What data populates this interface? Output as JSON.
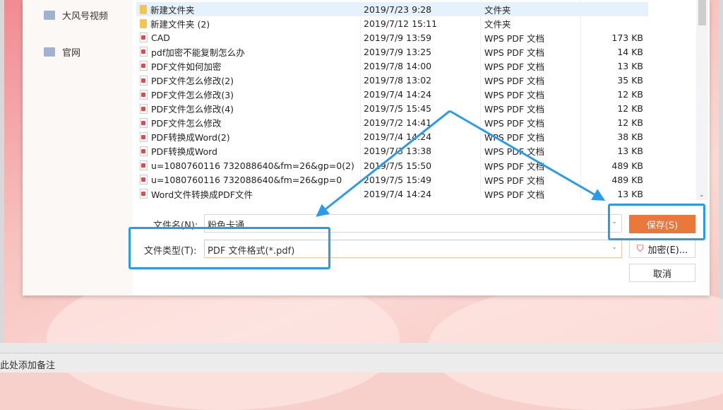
{
  "nav": {
    "items": [
      {
        "label": "大风号视频"
      },
      {
        "label": "官网"
      }
    ]
  },
  "files": [
    {
      "name": "新建文件夹",
      "date": "2019/7/23 9:28",
      "type": "文件夹",
      "size": "",
      "kind": "folder",
      "selected": true
    },
    {
      "name": "新建文件夹 (2)",
      "date": "2019/7/12 15:11",
      "type": "文件夹",
      "size": "",
      "kind": "folder"
    },
    {
      "name": "CAD",
      "date": "2019/7/9 13:59",
      "type": "WPS PDF 文档",
      "size": "173 KB",
      "kind": "pdf"
    },
    {
      "name": "pdf加密不能复制怎么办",
      "date": "2019/7/9 13:25",
      "type": "WPS PDF 文档",
      "size": "14 KB",
      "kind": "pdf"
    },
    {
      "name": "PDF文件如何加密",
      "date": "2019/7/8 14:00",
      "type": "WPS PDF 文档",
      "size": "13 KB",
      "kind": "pdf"
    },
    {
      "name": "PDF文件怎么修改(2)",
      "date": "2019/7/8 13:02",
      "type": "WPS PDF 文档",
      "size": "35 KB",
      "kind": "pdf"
    },
    {
      "name": "PDF文件怎么修改(3)",
      "date": "2019/7/4 14:24",
      "type": "WPS PDF 文档",
      "size": "12 KB",
      "kind": "pdf"
    },
    {
      "name": "PDF文件怎么修改(4)",
      "date": "2019/7/5 15:45",
      "type": "WPS PDF 文档",
      "size": "12 KB",
      "kind": "pdf"
    },
    {
      "name": "PDF文件怎么修改",
      "date": "2019/7/2 14:41",
      "type": "WPS PDF 文档",
      "size": "12 KB",
      "kind": "pdf"
    },
    {
      "name": "PDF转换成Word(2)",
      "date": "2019/7/4 14:24",
      "type": "WPS PDF 文档",
      "size": "38 KB",
      "kind": "pdf"
    },
    {
      "name": "PDF转换成Word",
      "date": "2019/7/3 13:38",
      "type": "WPS PDF 文档",
      "size": "13 KB",
      "kind": "pdf"
    },
    {
      "name": "u=1080760116 732088640&fm=26&gp=0(2)",
      "date": "2019/7/5 15:50",
      "type": "WPS PDF 文档",
      "size": "489 KB",
      "kind": "pdf"
    },
    {
      "name": "u=1080760116 732088640&fm=26&gp=0",
      "date": "2019/7/5 15:49",
      "type": "WPS PDF 文档",
      "size": "489 KB",
      "kind": "pdf"
    },
    {
      "name": "Word文件转换成PDF文件",
      "date": "2019/7/4 14:24",
      "type": "WPS PDF 文档",
      "size": "13 KB",
      "kind": "pdf"
    }
  ],
  "form": {
    "filename_label": "文件名(N):",
    "filename_value": "粉色卡通",
    "filetype_label": "文件类型(T):",
    "filetype_value": "PDF 文件格式(*.pdf)"
  },
  "buttons": {
    "save": "保存(S)",
    "encrypt": "加密(E)...",
    "cancel": "取消"
  },
  "status": {
    "note": "此处添加备注"
  },
  "colors": {
    "accent": "#e9783a",
    "annotation": "#2a9be8",
    "selection": "#e5f1fb"
  }
}
